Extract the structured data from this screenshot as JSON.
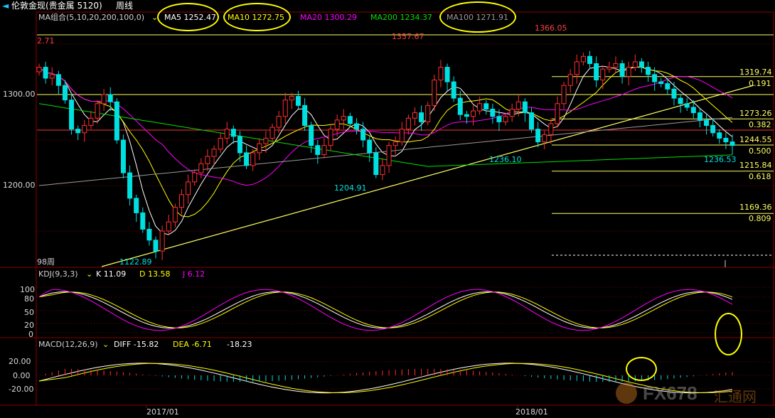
{
  "window": {
    "title": "伦敦金现(贵金属 5120)",
    "period": "周线",
    "icon_color": "#1ec8ff"
  },
  "ma_legend": {
    "group_label": "MA组合(5,10,20,200,100,0)",
    "items": [
      {
        "label": "MA5 1252.47",
        "color": "#ffffff"
      },
      {
        "label": "MA10 1272.75",
        "color": "#ffff00"
      },
      {
        "label": "MA20 1300.29",
        "color": "#ff00ff"
      },
      {
        "label": "MA200 1234.37",
        "color": "#00e000"
      },
      {
        "label": "MA100 1271.91",
        "color": "#9a9a9a"
      }
    ]
  },
  "price_axis": {
    "labels": [
      "1300.00",
      "1200.00"
    ]
  },
  "price_annotations": {
    "high_left": "2.71",
    "peak1": "1357.67",
    "peak2": "1366.05",
    "low1": "1122.89",
    "low2": "1204.91",
    "low3": "1236.10",
    "low4": "1236.53",
    "bars_count": "98周"
  },
  "fib_levels": [
    {
      "price": "1319.74",
      "ratio": "0.191"
    },
    {
      "price": "1273.26",
      "ratio": "0.382"
    },
    {
      "price": "1244.55",
      "ratio": "0.500"
    },
    {
      "price": "1215.84",
      "ratio": "0.618"
    },
    {
      "price": "1169.36",
      "ratio": "0.809"
    }
  ],
  "kdj": {
    "label": "KDJ(9,3,3)",
    "k": "K 11.09",
    "d": "D 13.58",
    "j": "J 6.12",
    "axis": [
      "100",
      "80",
      "50",
      "20",
      "0"
    ]
  },
  "macd": {
    "label": "MACD(12,26,9)",
    "diff": "DIFF -15.82",
    "dea": "DEA -6.71",
    "macd": "-18.23",
    "axis": [
      "20.00",
      "0.00",
      "-20.00"
    ]
  },
  "x_axis": {
    "labels": [
      "2017/01",
      "2018/01"
    ]
  },
  "watermark": {
    "text": "FX678",
    "cn": "汇通网"
  },
  "colors": {
    "up": "#ff3030",
    "down": "#00e0e0",
    "fib": "#ffff66",
    "annotation": "#ffff00",
    "grid": "#7a0000"
  }
}
